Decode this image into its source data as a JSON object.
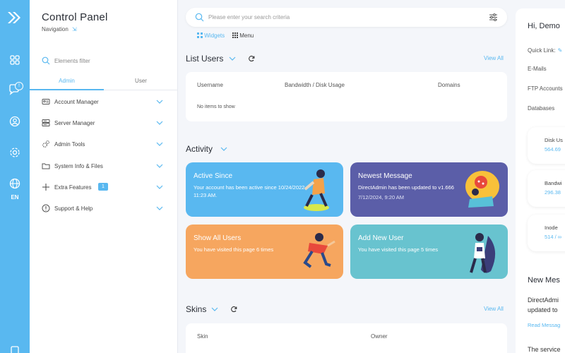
{
  "nav": {
    "title": "Control Panel",
    "subtitle": "Navigation",
    "filter_placeholder": "Elements filter",
    "tabs": [
      {
        "label": "Admin"
      },
      {
        "label": "User"
      }
    ],
    "items": [
      {
        "label": "Account Manager"
      },
      {
        "label": "Server Manager"
      },
      {
        "label": "Admin Tools"
      },
      {
        "label": "System Info & Files"
      },
      {
        "label": "Extra Features",
        "count": "1"
      },
      {
        "label": "Support & Help"
      }
    ]
  },
  "rail": {
    "language": "EN",
    "notification_count": "!"
  },
  "search": {
    "placeholder": "Please enter your search criteria"
  },
  "view_tabs": {
    "widgets": "Widgets",
    "menu": "Menu"
  },
  "list_users": {
    "title": "List Users",
    "view_all": "View All",
    "columns": [
      "Username",
      "Bandwidth / Disk Usage",
      "Domains"
    ],
    "empty": "No items to show"
  },
  "activity": {
    "title": "Activity",
    "cards": [
      {
        "title": "Active Since",
        "text": "Your account has been active since 10/24/2022, 11:23 AM."
      },
      {
        "title": "Newest Message",
        "text": "DirectAdmin has been updated to v1.666",
        "sub": "7/12/2024, 9:20 AM"
      },
      {
        "title": "Show All Users",
        "text": "You have visited this page 6 times"
      },
      {
        "title": "Add New User",
        "text": "You have visited this page 5 times"
      }
    ]
  },
  "skins": {
    "title": "Skins",
    "view_all": "View All",
    "columns": [
      "Skin",
      "Owner"
    ]
  },
  "right": {
    "greeting": "Hi, Demo",
    "quick_link": "Quick Link:",
    "rows": [
      "E-Mails",
      "FTP Accounts",
      "Databases"
    ],
    "stats": [
      {
        "label": "Disk Us",
        "value": "564.69 "
      },
      {
        "label": "Bandwi",
        "value": "296.38 "
      },
      {
        "label": "Inode",
        "value": "514  / ∞"
      }
    ],
    "new_messages": "New Mes",
    "message_text": "DirectAdmi updated to",
    "read_message": "Read Messag",
    "service": "The service"
  },
  "colors": {
    "accent": "#59b8f0",
    "card_blue": "#59b8f0",
    "card_purple": "#5b5ea8",
    "card_orange": "#f6a65f",
    "card_teal": "#68c3cf"
  }
}
